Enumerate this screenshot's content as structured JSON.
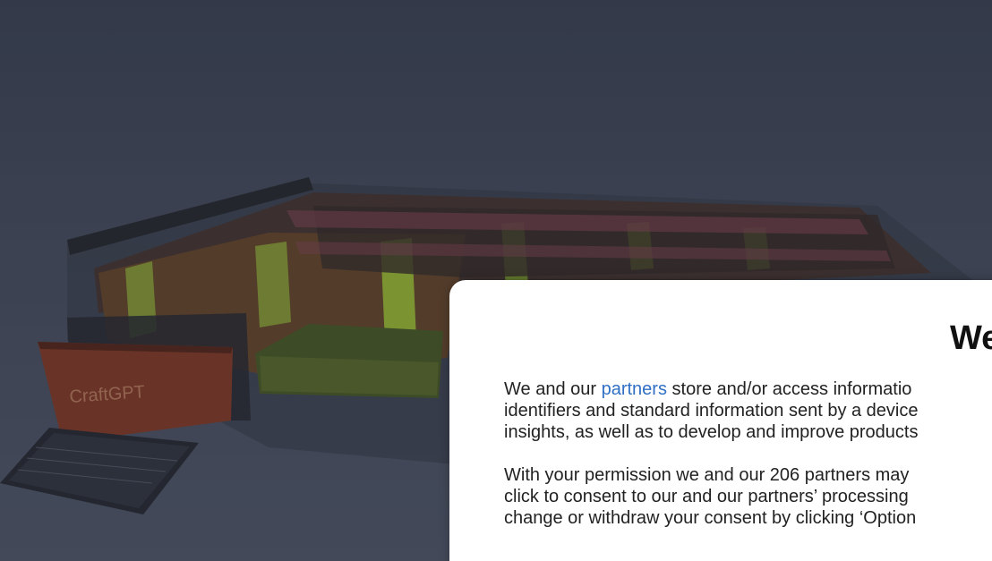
{
  "video": {
    "watermark_logo": "CraftGPT",
    "description_icon": "minecraft-build-scene"
  },
  "consent": {
    "title": "We",
    "paragraph1": {
      "prefix": "We and our ",
      "link": "partners",
      "line1_rest": " store and/or access informatio",
      "line2": "identifiers and standard information sent by a device",
      "line3": "insights, as well as to develop and improve products"
    },
    "paragraph2": {
      "line1": "With your permission we and our 206 partners may",
      "line2": "click to consent to our and our partners’ processing",
      "line3": "change or withdraw your consent by clicking ‘Option"
    }
  },
  "colors": {
    "link": "#2f6fc4",
    "dialog_bg": "#ffffff",
    "backdrop": "#4a5060"
  }
}
